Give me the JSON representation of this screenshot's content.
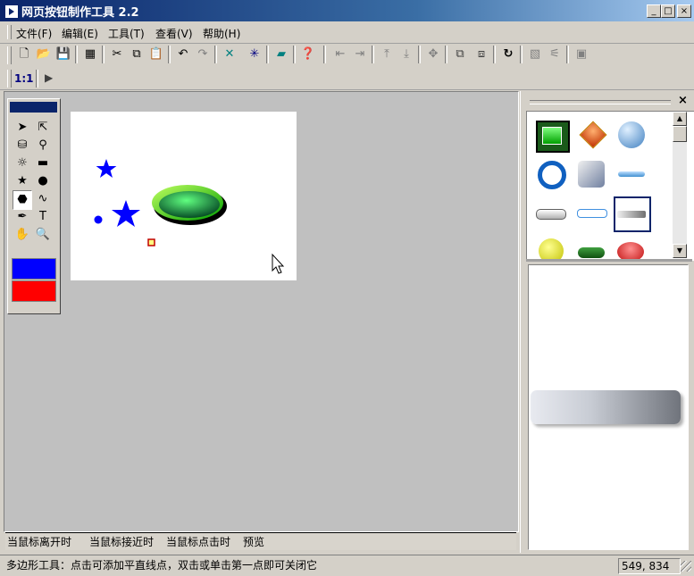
{
  "window": {
    "title": "网页按钮制作工具 2.2",
    "min": "_",
    "max": "□",
    "close": "×"
  },
  "menu": [
    {
      "label": "文件(F)"
    },
    {
      "label": "编辑(E)"
    },
    {
      "label": "工具(T)"
    },
    {
      "label": "查看(V)"
    },
    {
      "label": "帮助(H)"
    }
  ],
  "toolbar2": {
    "zoom_label": "1:1",
    "preview_glyph": "▶"
  },
  "palette": {
    "colors": {
      "stroke": "#0000ff",
      "fill": "#ff0000",
      "header": "#0a246a"
    },
    "text_tool_glyph": "T"
  },
  "canvas": {
    "star_color": "#0000ff",
    "button_gradient": [
      "#00c080",
      "#b0f080"
    ]
  },
  "right_panel": {
    "close_glyph": "×",
    "scroll_up": "▲",
    "scroll_down": "▼"
  },
  "tabs": [
    {
      "label": "当鼠标离开时"
    },
    {
      "label": "当鼠标接近时"
    },
    {
      "label": "当鼠标点击时"
    },
    {
      "label": "预览"
    }
  ],
  "status": {
    "message": "多边形工具：点击可添加平直线点，双击或单击第一点即可关闭它",
    "coords": "549, 834"
  }
}
